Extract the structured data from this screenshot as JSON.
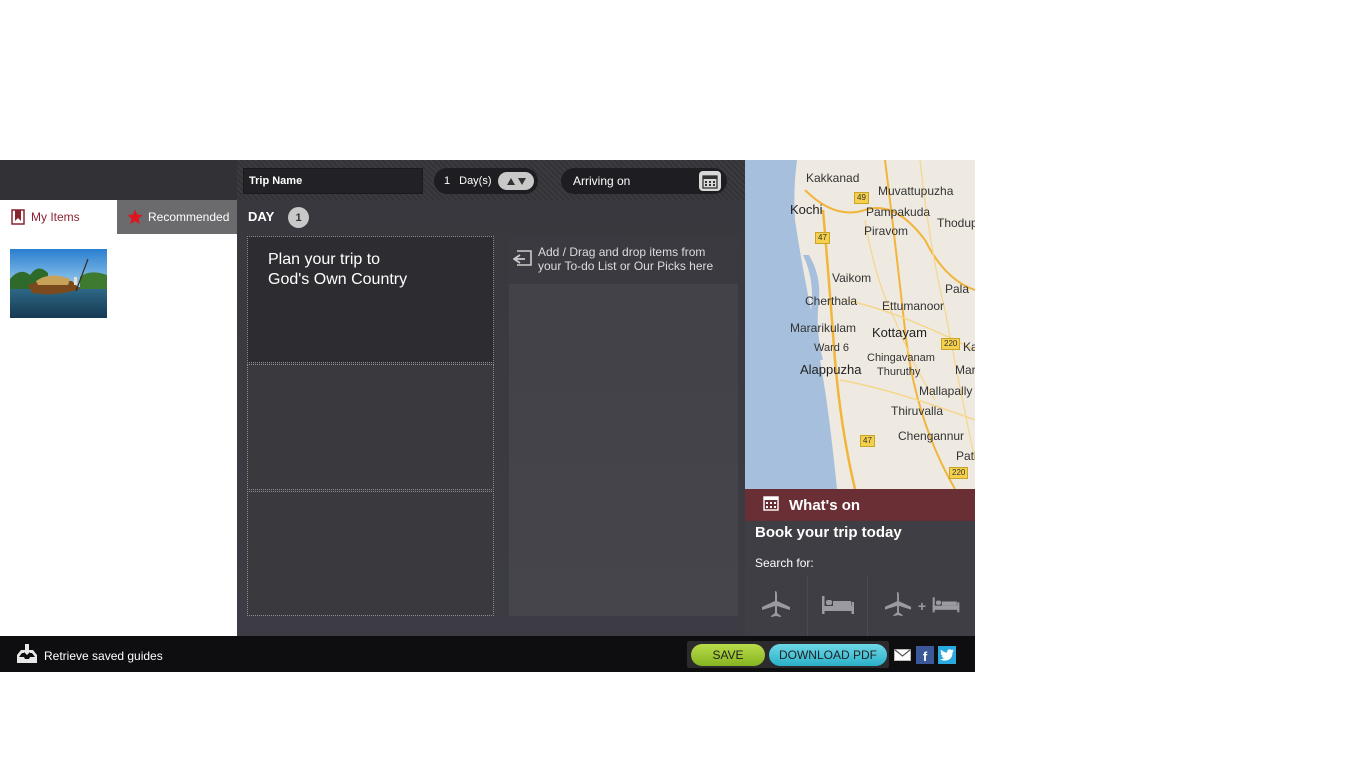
{
  "tabs": {
    "my_items": "My Items",
    "recommended": "Recommended"
  },
  "header": {
    "trip_name": "Trip Name",
    "days_count": "1",
    "days_label": "Day(s)",
    "arriving_label": "Arriving on"
  },
  "day": {
    "label": "DAY",
    "number": "1"
  },
  "plan": {
    "line1": "Plan your trip to",
    "line2": "God's Own Country"
  },
  "drop_hint": {
    "line1": "Add / Drag and drop items from",
    "line2": "your To-do List or Our Picks here"
  },
  "map": {
    "labels": {
      "kakkanad": "Kakkanad",
      "muvattupuzha": "Muvattupuzha",
      "kochi": "Kochi",
      "pampakuda": "Pampakuda",
      "thodupuzha": "Thodup",
      "piravom": "Piravom",
      "vaikom": "Vaikom",
      "cherthala": "Cherthala",
      "pala": "Pala",
      "ettumanoor": "Ettumanoor",
      "mararikulam": "Mararikulam",
      "kottayam": "Kottayam",
      "ward6": "Ward 6",
      "chingavanam": "Chingavanam",
      "ka": "Ka",
      "alappuzha": "Alappuzha",
      "thuruthy": "Thuruthy",
      "mar": "Mar",
      "mallappally": "Mallapally",
      "thiruvalla": "Thiruvalla",
      "chengannur": "Chengannur",
      "path": "Path"
    },
    "roads": {
      "r49": "49",
      "r47a": "47",
      "r220a": "220",
      "r47b": "47",
      "r220b": "220"
    }
  },
  "whats_on": "What's on",
  "book": {
    "title": "Book your trip today",
    "search_for": "Search for:"
  },
  "footer": {
    "retrieve": "Retrieve saved guides",
    "save": "SAVE",
    "download": "DOWNLOAD PDF",
    "fb": "f"
  },
  "colors": {
    "accent_maroon": "#6a2e35",
    "save_green": "#9ac533",
    "pdf_cyan": "#4cc4d8",
    "dark_bg": "#3e3e44"
  }
}
